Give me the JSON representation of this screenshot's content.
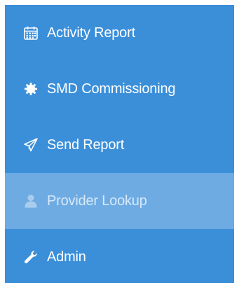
{
  "menu": {
    "items": [
      {
        "label": "Activity Report",
        "icon": "calendar-icon"
      },
      {
        "label": "SMD Commissioning",
        "icon": "gear-icon"
      },
      {
        "label": "Send Report",
        "icon": "paper-plane-icon"
      },
      {
        "label": "Provider Lookup",
        "icon": "user-tie-icon",
        "active": true
      },
      {
        "label": "Admin",
        "icon": "wrench-icon"
      }
    ]
  },
  "colors": {
    "menu_background": "#3b8fd9",
    "active_background": "#6eabe3",
    "text": "#ffffff",
    "active_text": "#d7e8f8"
  }
}
